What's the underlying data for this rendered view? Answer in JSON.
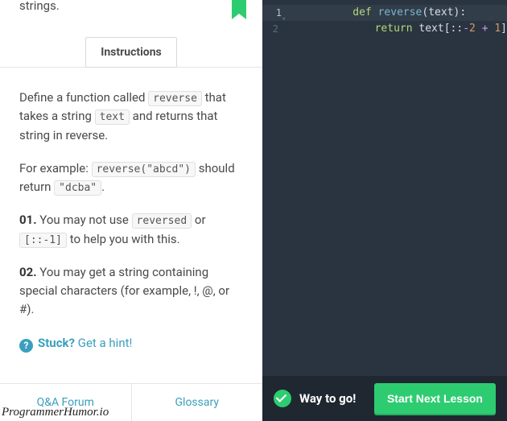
{
  "top_fragment": "strings.",
  "tab_label": "Instructions",
  "instructions": {
    "p1_a": "Define a function called ",
    "p1_code1": "reverse",
    "p1_b": " that takes a string ",
    "p1_code2": "text",
    "p1_c": " and returns that string in reverse.",
    "p2_a": "For example: ",
    "p2_code1": "reverse(\"abcd\")",
    "p2_b": " should return ",
    "p2_code2": "\"dcba\"",
    "p2_c": ".",
    "r1_num": "01.",
    "r1_a": " You may not use ",
    "r1_code1": "reversed",
    "r1_b": " or ",
    "r1_code2": "[::-1]",
    "r1_c": " to help you with this.",
    "r2_num": "02.",
    "r2_a": " You may get a string containing special characters (for example, !, @, or #)."
  },
  "hint": {
    "stuck": "Stuck?",
    "cta": " Get a hint!"
  },
  "footer": {
    "qa": "Q&A Forum",
    "glossary": "Glossary"
  },
  "editor": {
    "line1_num": "1",
    "line2_num": "2",
    "l1_kw": "def",
    "l1_sp1": " ",
    "l1_fn": "reverse",
    "l1_open": "(",
    "l1_arg": "text",
    "l1_close": ")",
    "l1_colon": ":",
    "l2_indent": "    ",
    "l2_kw": "return",
    "l2_sp": " ",
    "l2_obj": "text",
    "l2_b1": "[",
    "l2_colon1": ":",
    "l2_colon2": ":",
    "l2_neg": "-",
    "l2_two": "2",
    "l2_sp2": " ",
    "l2_plus": "+",
    "l2_sp3": " ",
    "l2_one": "1",
    "l2_b2": "]"
  },
  "status": {
    "msg": "Way to go!",
    "button": "Start Next Lesson"
  },
  "watermark": "ProgrammerHumor.io"
}
